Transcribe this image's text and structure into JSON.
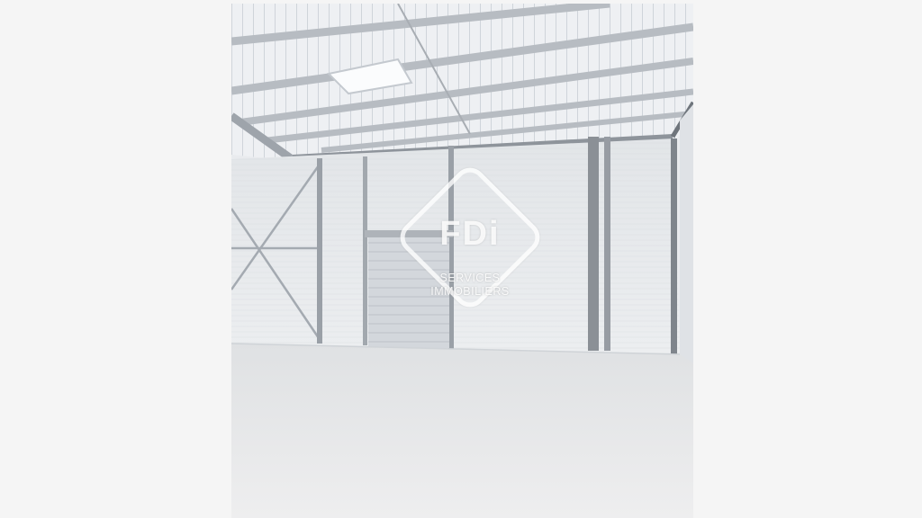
{
  "watermark": {
    "logo": "FDi",
    "line1": "SERVICES",
    "line2": "IMMOBILIERS"
  },
  "colors": {
    "page_background": "#f5f5f5",
    "wall": "#e6e8eb",
    "floor": "#e9eaeb",
    "steel": "#8b9096"
  }
}
